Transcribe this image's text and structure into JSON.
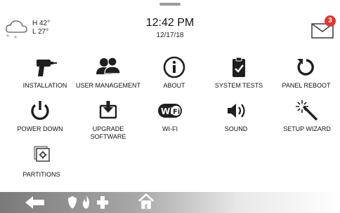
{
  "weather": {
    "high": "H 42°",
    "low": "L 27°",
    "icon": "snow-cloud-icon"
  },
  "clock": {
    "time": "12:42 PM",
    "date": "12/17/18"
  },
  "messages": {
    "icon": "envelope-icon",
    "badge_count": "3",
    "badge_color": "#e3342f"
  },
  "tiles": [
    {
      "label": "INSTALLATION",
      "icon": "drill-icon"
    },
    {
      "label": "USER MANAGEMENT",
      "icon": "users-icon"
    },
    {
      "label": "ABOUT",
      "icon": "info-icon"
    },
    {
      "label": "SYSTEM TESTS",
      "icon": "clipboard-check-icon"
    },
    {
      "label": "PANEL REBOOT",
      "icon": "reboot-icon"
    },
    {
      "label": "POWER DOWN",
      "icon": "power-icon"
    },
    {
      "label": "UPGRADE SOFTWARE",
      "icon": "download-icon"
    },
    {
      "label": "WI-FI",
      "icon": "wifi-icon"
    },
    {
      "label": "SOUND",
      "icon": "speaker-icon"
    },
    {
      "label": "SETUP WIZARD",
      "icon": "magic-wand-icon"
    },
    {
      "label": "PARTITIONS",
      "icon": "partitions-icon"
    }
  ],
  "bottom_bar": {
    "back_icon": "back-arrow-icon",
    "emergency_icons": [
      "police-shield-icon",
      "fire-icon",
      "medical-cross-icon"
    ],
    "home_icon": "home-icon"
  },
  "colors": {
    "icon": "#1f1f1f",
    "badge": "#e3342f",
    "bar_dark": "#7a7a7a"
  }
}
